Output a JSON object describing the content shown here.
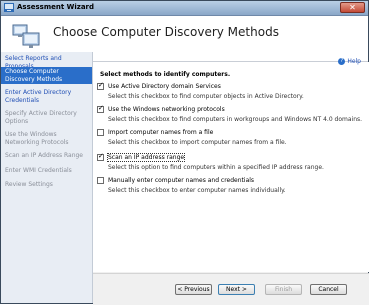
{
  "window": {
    "title": "Assessment Wizard",
    "close_glyph": "✕"
  },
  "header": {
    "title": "Choose Computer Discovery Methods"
  },
  "nav": [
    {
      "label": "Select Reports and Proposals",
      "state": "link"
    },
    {
      "label": "Choose Computer Discovery Methods",
      "state": "active"
    },
    {
      "label": "Enter Active Directory Credentials",
      "state": "link"
    },
    {
      "label": "Specify Active Directory Options",
      "state": "disabled"
    },
    {
      "label": "Use the Windows Networking Protocols",
      "state": "disabled"
    },
    {
      "label": "Scan an IP Address Range",
      "state": "disabled"
    },
    {
      "label": "Enter WMI Credentials",
      "state": "disabled"
    },
    {
      "label": "Review Settings",
      "state": "disabled"
    }
  ],
  "content": {
    "help_label": "Help",
    "section_title": "Select methods to identify computers.",
    "options": [
      {
        "label": "Use Active Directory domain Services",
        "description": "Select this checkbox to find computer objects in Active Directory.",
        "checked": true
      },
      {
        "label": "Use the Windows networking protocols",
        "description": "Select this checkbox to find computers in workgroups and Windows NT 4.0 domains.",
        "checked": true
      },
      {
        "label": "Import computer names from a file",
        "description": "Select this checkbox to import computer names from a file.",
        "checked": false
      },
      {
        "label": "Scan an IP address range",
        "description": "Select this option to find computers within a specified IP address range.",
        "checked": true
      },
      {
        "label": "Manually enter computer names and credentials",
        "description": "Select this checkbox to enter computer names individually.",
        "checked": false
      }
    ]
  },
  "footer": {
    "previous_label": "< Previous",
    "next_label": "Next >",
    "finish_label": "Finish",
    "cancel_label": "Cancel"
  }
}
